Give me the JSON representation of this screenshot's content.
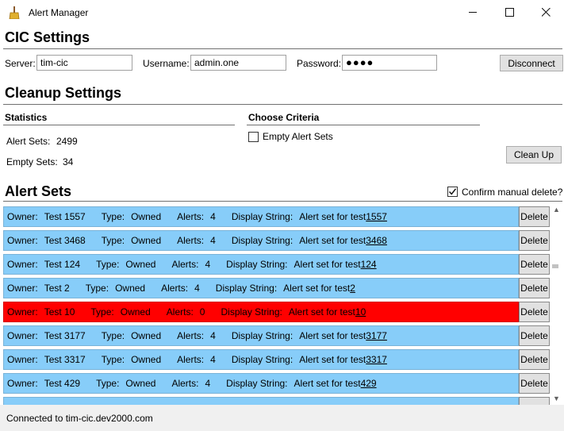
{
  "window": {
    "title": "Alert Manager",
    "icon": "broom-icon"
  },
  "cic": {
    "heading": "CIC Settings",
    "server_label": "Server:",
    "server_value": "tim-cic",
    "username_label": "Username:",
    "username_value": "admin.one",
    "password_label": "Password:",
    "password_value": "●●●●",
    "disconnect_label": "Disconnect"
  },
  "cleanup": {
    "heading": "Cleanup Settings",
    "statistics_heading": "Statistics",
    "alert_sets_label": "Alert Sets:",
    "alert_sets_value": "2499",
    "empty_sets_label": "Empty Sets:",
    "empty_sets_value": "34",
    "criteria_heading": "Choose Criteria",
    "empty_alert_sets_label": "Empty Alert Sets",
    "empty_alert_sets_checked": false,
    "clean_up_label": "Clean Up"
  },
  "alert_sets": {
    "heading": "Alert Sets",
    "confirm_label": "Confirm manual delete?",
    "confirm_checked": true,
    "owner_label": "Owner:",
    "type_label": "Type:",
    "alerts_label": "Alerts:",
    "display_label": "Display String:",
    "display_prefix": "Alert set for test",
    "delete_label": "Delete",
    "rows": [
      {
        "owner": "Test 1557",
        "type": "Owned",
        "alerts": "4",
        "num": "1557",
        "highlight": false
      },
      {
        "owner": "Test 3468",
        "type": "Owned",
        "alerts": "4",
        "num": "3468",
        "highlight": false
      },
      {
        "owner": "Test 124",
        "type": "Owned",
        "alerts": "4",
        "num": "124",
        "highlight": false
      },
      {
        "owner": "Test 2",
        "type": "Owned",
        "alerts": "4",
        "num": "2",
        "highlight": false
      },
      {
        "owner": "Test 10",
        "type": "Owned",
        "alerts": "0",
        "num": "10",
        "highlight": true
      },
      {
        "owner": "Test 3177",
        "type": "Owned",
        "alerts": "4",
        "num": "3177",
        "highlight": false
      },
      {
        "owner": "Test 3317",
        "type": "Owned",
        "alerts": "4",
        "num": "3317",
        "highlight": false
      },
      {
        "owner": "Test 429",
        "type": "Owned",
        "alerts": "4",
        "num": "429",
        "highlight": false
      }
    ]
  },
  "status": {
    "text": "Connected to tim-cic.dev2000.com"
  },
  "colors": {
    "row_normal": "#87cdf9",
    "row_alert": "#ff0000"
  }
}
